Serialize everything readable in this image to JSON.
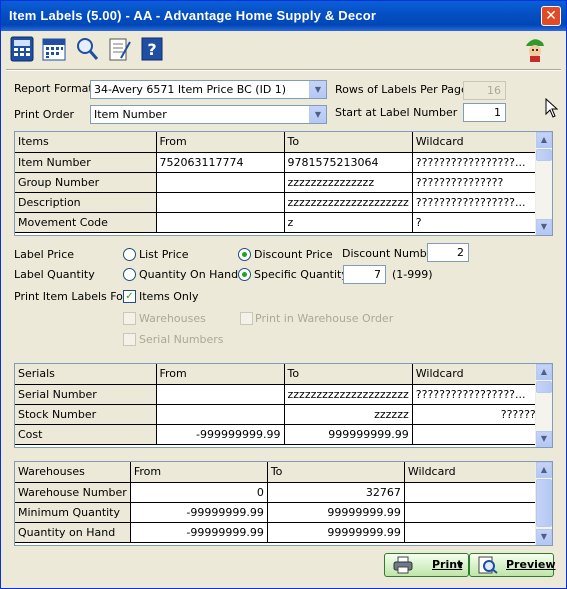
{
  "window": {
    "title": "Item Labels (5.00) - AA - Advantage Home Supply & Decor",
    "close_glyph": "✕"
  },
  "toolbar": {
    "icons": [
      "calculator-icon",
      "calendar-icon",
      "magnifier-icon",
      "notepad-icon",
      "help-icon",
      "mascot-icon"
    ]
  },
  "form": {
    "report_format_label": "Report Format",
    "report_format_value": "34-Avery 6571 Item Price BC (ID 1)",
    "print_order_label": "Print Order",
    "print_order_value": "Item Number",
    "rows_per_page_label": "Rows of Labels Per Page",
    "rows_per_page_value": "16",
    "start_label_label": "Start at Label Number",
    "start_label_value": "1"
  },
  "items_grid": {
    "headers": [
      "Items",
      "From",
      "To",
      "Wildcard"
    ],
    "rows": [
      [
        "Item Number",
        "752063117774",
        "9781575213064",
        "?????????????????..."
      ],
      [
        "Group Number",
        "",
        "zzzzzzzzzzzzzzz",
        "???????????????"
      ],
      [
        "Description",
        "",
        "zzzzzzzzzzzzzzzzzzzzz",
        "?????????????????..."
      ],
      [
        "Movement Code",
        "",
        "z",
        "?"
      ]
    ]
  },
  "options": {
    "label_price_label": "Label Price",
    "list_price": "List Price",
    "discount_price": "Discount Price",
    "discount_number_label": "Discount Number",
    "discount_number_value": "2",
    "label_quantity_label": "Label Quantity",
    "quantity_on_hand": "Quantity On Hand",
    "specific_quantity": "Specific Quantity",
    "specific_quantity_value": "7",
    "quantity_range": "(1-999)",
    "print_for_label": "Print Item Labels For",
    "items_only": "Items Only",
    "warehouses": "Warehouses",
    "print_in_warehouse_order": "Print in Warehouse Order",
    "serial_numbers": "Serial Numbers"
  },
  "serials_grid": {
    "headers": [
      "Serials",
      "From",
      "To",
      "Wildcard"
    ],
    "rows": [
      [
        "Serial Number",
        "",
        "zzzzzzzzzzzzzzzzzzzzz",
        "?????????????????..."
      ],
      [
        "Stock Number",
        "",
        "zzzzzz",
        "??????"
      ],
      [
        "Cost",
        "-999999999.99",
        "999999999.99",
        ""
      ]
    ]
  },
  "warehouses_grid": {
    "headers": [
      "Warehouses",
      "From",
      "To",
      "Wildcard"
    ],
    "rows": [
      [
        "Warehouse Number",
        "0",
        "32767",
        ""
      ],
      [
        "Minimum Quantity",
        "-99999999.99",
        "99999999.99",
        ""
      ],
      [
        "Quantity on Hand",
        "-99999999.99",
        "99999999.99",
        ""
      ]
    ]
  },
  "buttons": {
    "print": "Print",
    "preview": "Preview"
  },
  "colors": {
    "title_bar": "#0650c5",
    "close_button": "#e14a24",
    "window_bg": "#ece9d8",
    "button_green": "#bfe5a8"
  }
}
